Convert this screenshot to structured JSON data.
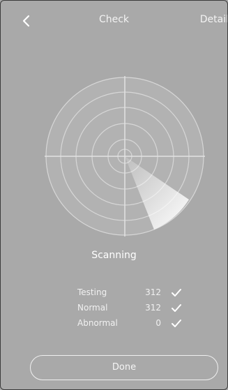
{
  "header": {
    "title": "Check",
    "detail_label": "Detail",
    "back_icon": "chevron-left-icon"
  },
  "scan": {
    "status": "Scanning"
  },
  "stats": [
    {
      "label": "Testing",
      "value": "312",
      "icon": "check-icon"
    },
    {
      "label": "Normal",
      "value": "312",
      "icon": "check-icon"
    },
    {
      "label": "Abnormal",
      "value": "0",
      "icon": "check-icon"
    }
  ],
  "footer": {
    "done_label": "Done"
  }
}
